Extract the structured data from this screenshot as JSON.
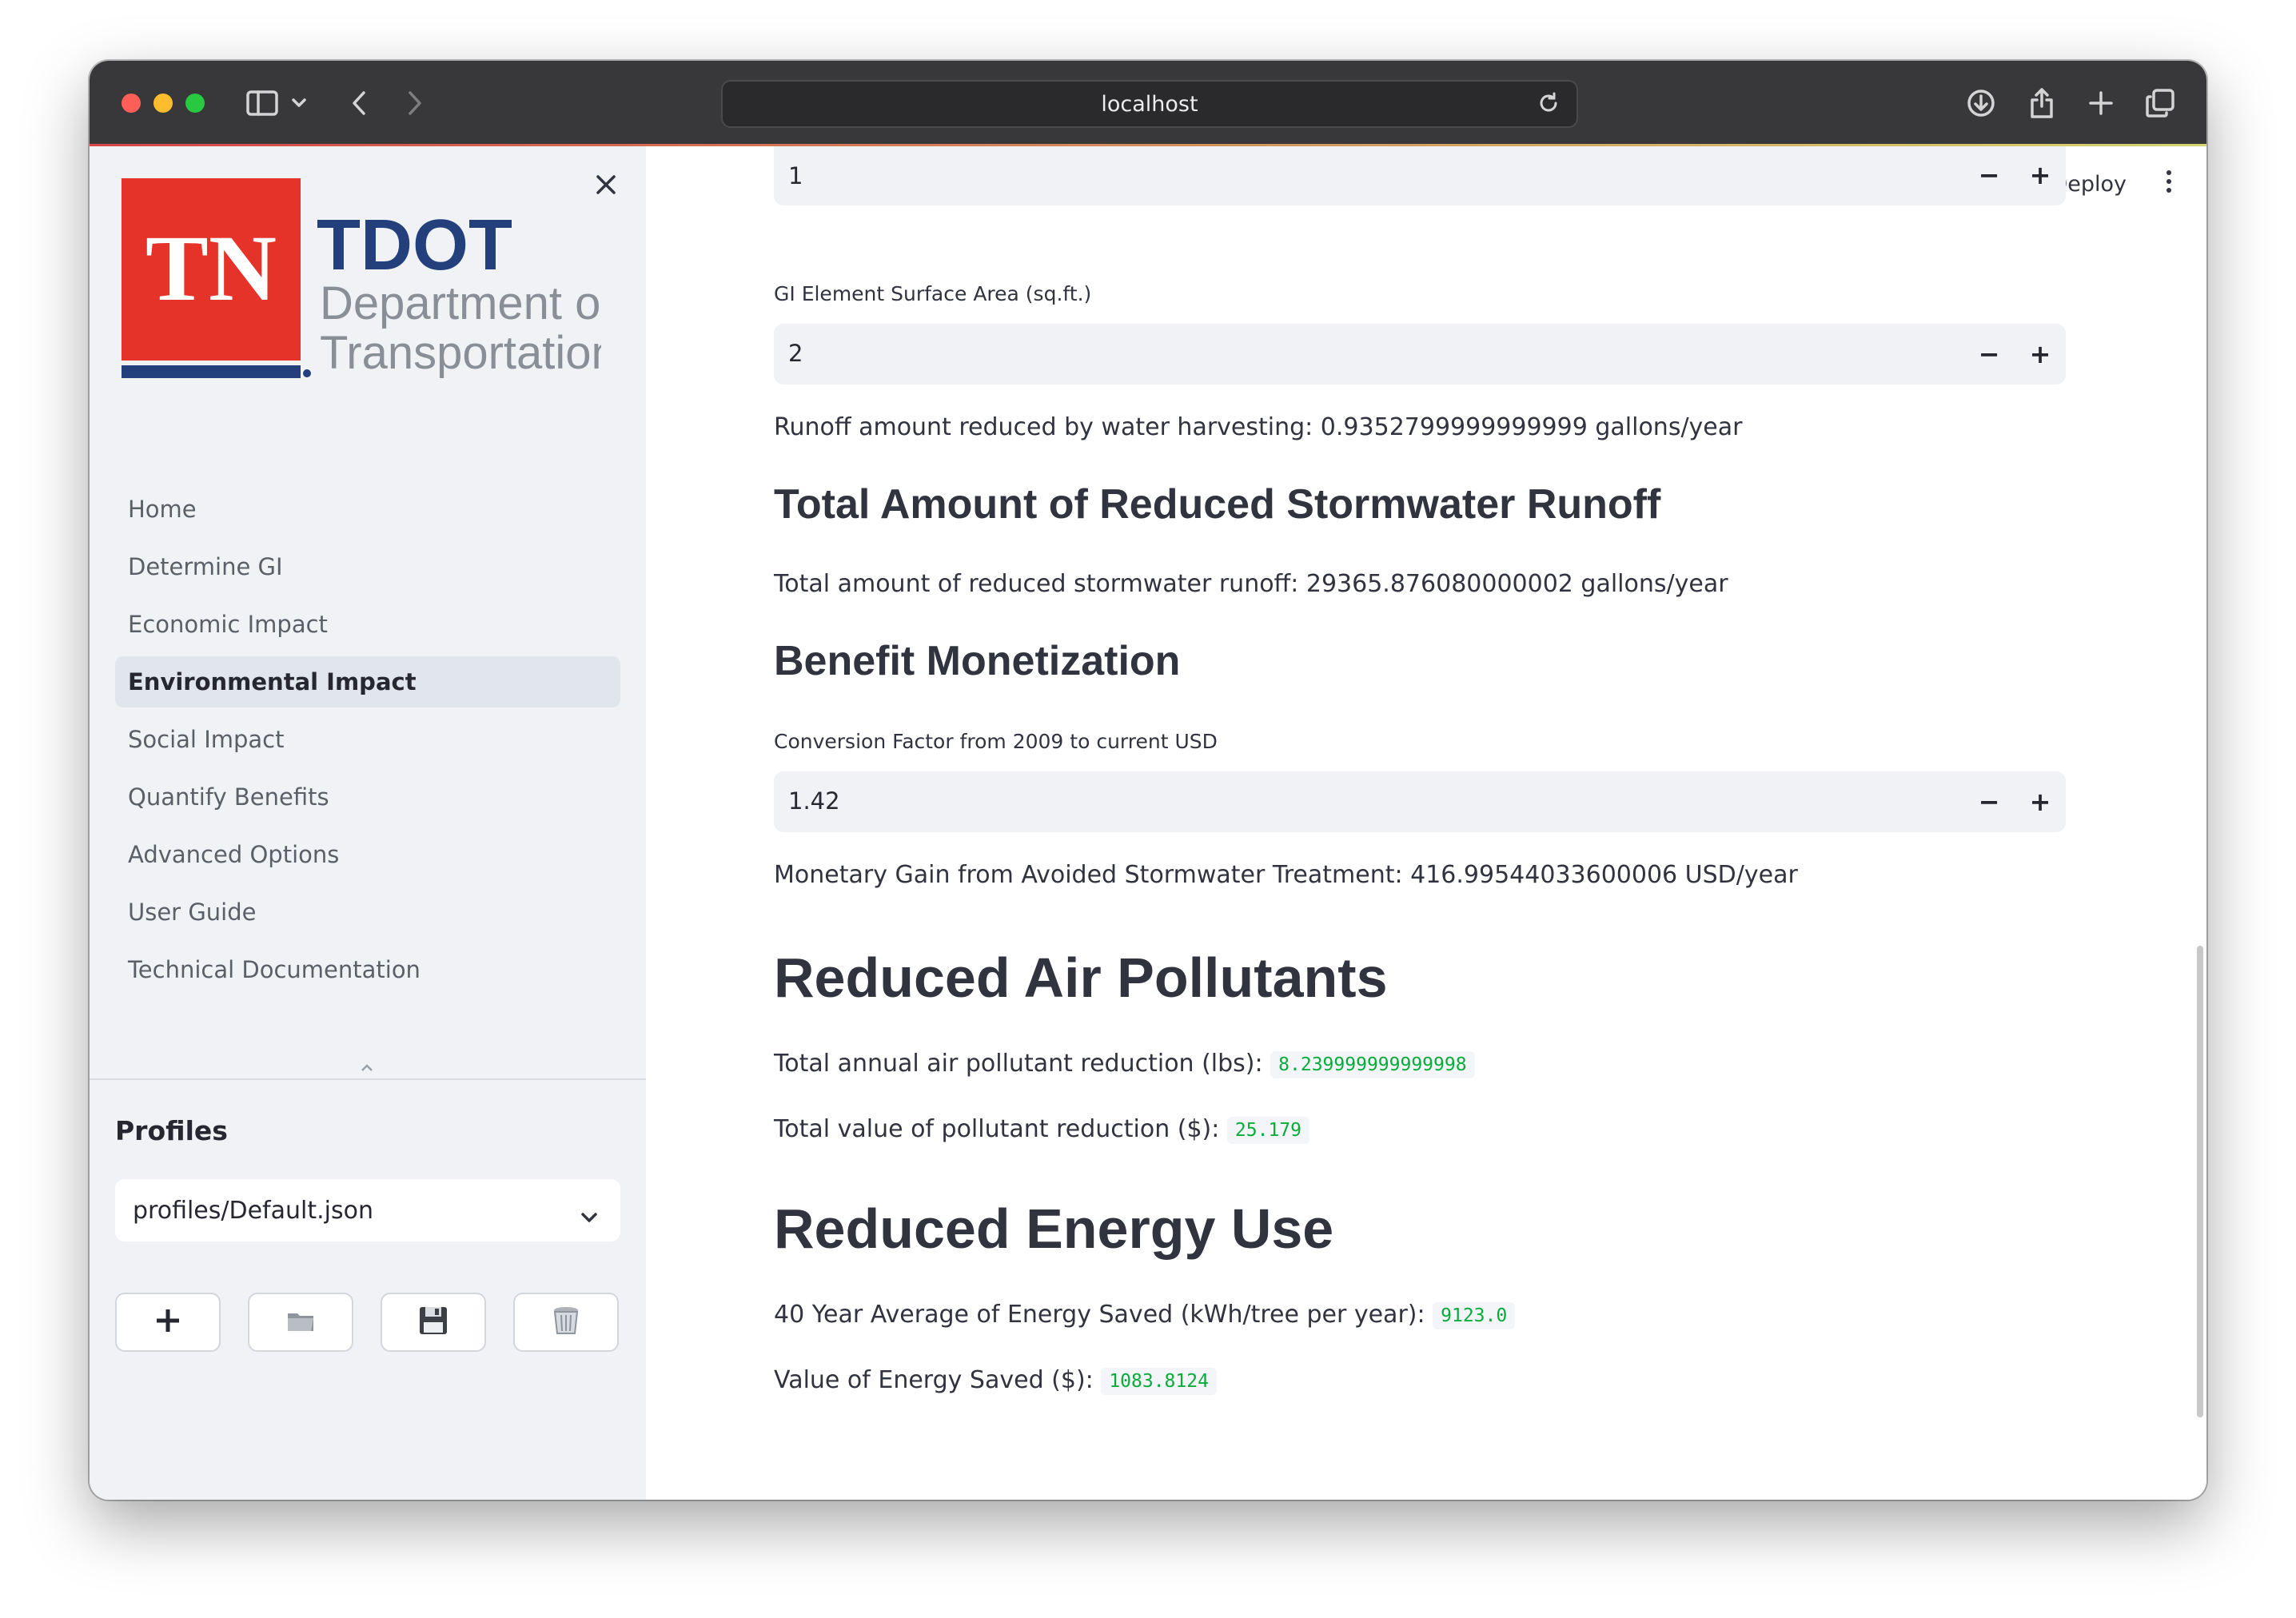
{
  "browser": {
    "url": "localhost"
  },
  "sidebar": {
    "logo": {
      "mark": "TN",
      "brand": "TDOT",
      "line1": "Department of",
      "line2": "Transportation"
    },
    "nav_items": [
      {
        "label": "Home",
        "active": false
      },
      {
        "label": "Determine GI",
        "active": false
      },
      {
        "label": "Economic Impact",
        "active": false
      },
      {
        "label": "Environmental Impact",
        "active": true
      },
      {
        "label": "Social Impact",
        "active": false
      },
      {
        "label": "Quantify Benefits",
        "active": false
      },
      {
        "label": "Advanced Options",
        "active": false
      },
      {
        "label": "User Guide",
        "active": false
      },
      {
        "label": "Technical Documentation",
        "active": false
      }
    ],
    "profiles_title": "Profiles",
    "profile_selected": "profiles/Default.json",
    "buttons": [
      "new-profile",
      "open-profile",
      "save-profile",
      "delete-profile"
    ]
  },
  "header": {
    "deploy_label": "Deploy"
  },
  "main": {
    "input_top_value": "1",
    "gi_area_label": "GI Element Surface Area (sq.ft.)",
    "gi_area_value": "2",
    "runoff_harvest_text": "Runoff amount reduced by water harvesting: 0.9352799999999999 gallons/year",
    "total_runoff_heading": "Total Amount of Reduced Stormwater Runoff",
    "total_runoff_text": "Total amount of reduced stormwater runoff: 29365.876080000002 gallons/year",
    "benefit_heading": "Benefit Monetization",
    "conversion_label": "Conversion Factor from 2009 to current USD",
    "conversion_value": "1.42",
    "monetary_gain_text": "Monetary Gain from Avoided Stormwater Treatment: 416.99544033600006 USD/year",
    "air_heading": "Reduced Air Pollutants",
    "air_reduction_label": "Total annual air pollutant reduction (lbs):",
    "air_reduction_value": "8.239999999999998",
    "air_value_label": "Total value of pollutant reduction ($):",
    "air_value_value": "25.179",
    "energy_heading": "Reduced Energy Use",
    "energy_avg_label": "40 Year Average of Energy Saved (kWh/tree per year):",
    "energy_avg_value": "9123.0",
    "energy_value_label": "Value of Energy Saved ($):",
    "energy_value_value": "1083.8124"
  }
}
